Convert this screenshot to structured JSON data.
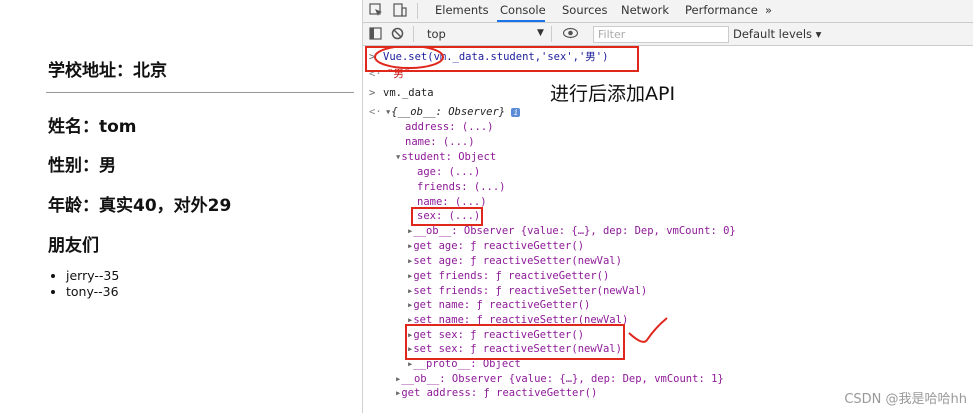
{
  "page": {
    "school_address": "学校地址：北京",
    "name": "姓名：tom",
    "gender": "性别：男",
    "age": "年龄：真实40，对外29",
    "friends_title": "朋友们",
    "friends": [
      "jerry--35",
      "tony--36"
    ]
  },
  "devtools": {
    "tabs": [
      "Elements",
      "Console",
      "Sources",
      "Network",
      "Performance",
      "»"
    ],
    "active_tab": "Console",
    "context": "top",
    "filter_placeholder": "Filter",
    "levels": "Default levels ▾",
    "icons": [
      "cursor-icon",
      "device-icon",
      "sidebar-icon",
      "block-icon",
      "eye-icon"
    ]
  },
  "console": {
    "command1": "Vue.set(vm._data.student,'sex','男')",
    "result1": "\"男\"",
    "command2": "vm._data",
    "root": "{__ob__: Observer}",
    "address": "address: (...)",
    "name": "name: (...)",
    "student": "student: Object",
    "student_age": "age: (...)",
    "student_friends": "friends: (...)",
    "student_name": "name: (...)",
    "student_sex": "sex: (...)",
    "student_ob": "__ob__: Observer {value: {…}, dep: Dep, vmCount: 0}",
    "get_age": "get age: ƒ reactiveGetter()",
    "set_age": "set age: ƒ reactiveSetter(newVal)",
    "get_friends": "get friends: ƒ reactiveGetter()",
    "set_friends": "set friends: ƒ reactiveSetter(newVal)",
    "get_name": "get name: ƒ reactiveGetter()",
    "set_name": "set name: ƒ reactiveSetter(newVal)",
    "get_sex": "get sex: ƒ reactiveGetter()",
    "set_sex": "set sex: ƒ reactiveSetter(newVal)",
    "proto": "__proto__: Object",
    "root_ob": "__ob__: Observer {value: {…}, dep: Dep, vmCount: 1}",
    "get_address": "get address: ƒ reactiveGetter()"
  },
  "annotation": "进行后添加API",
  "watermark": "CSDN @我是哈哈hh",
  "colors": {
    "highlight": "#e0271c",
    "tab_underline": "#1a73e8"
  }
}
